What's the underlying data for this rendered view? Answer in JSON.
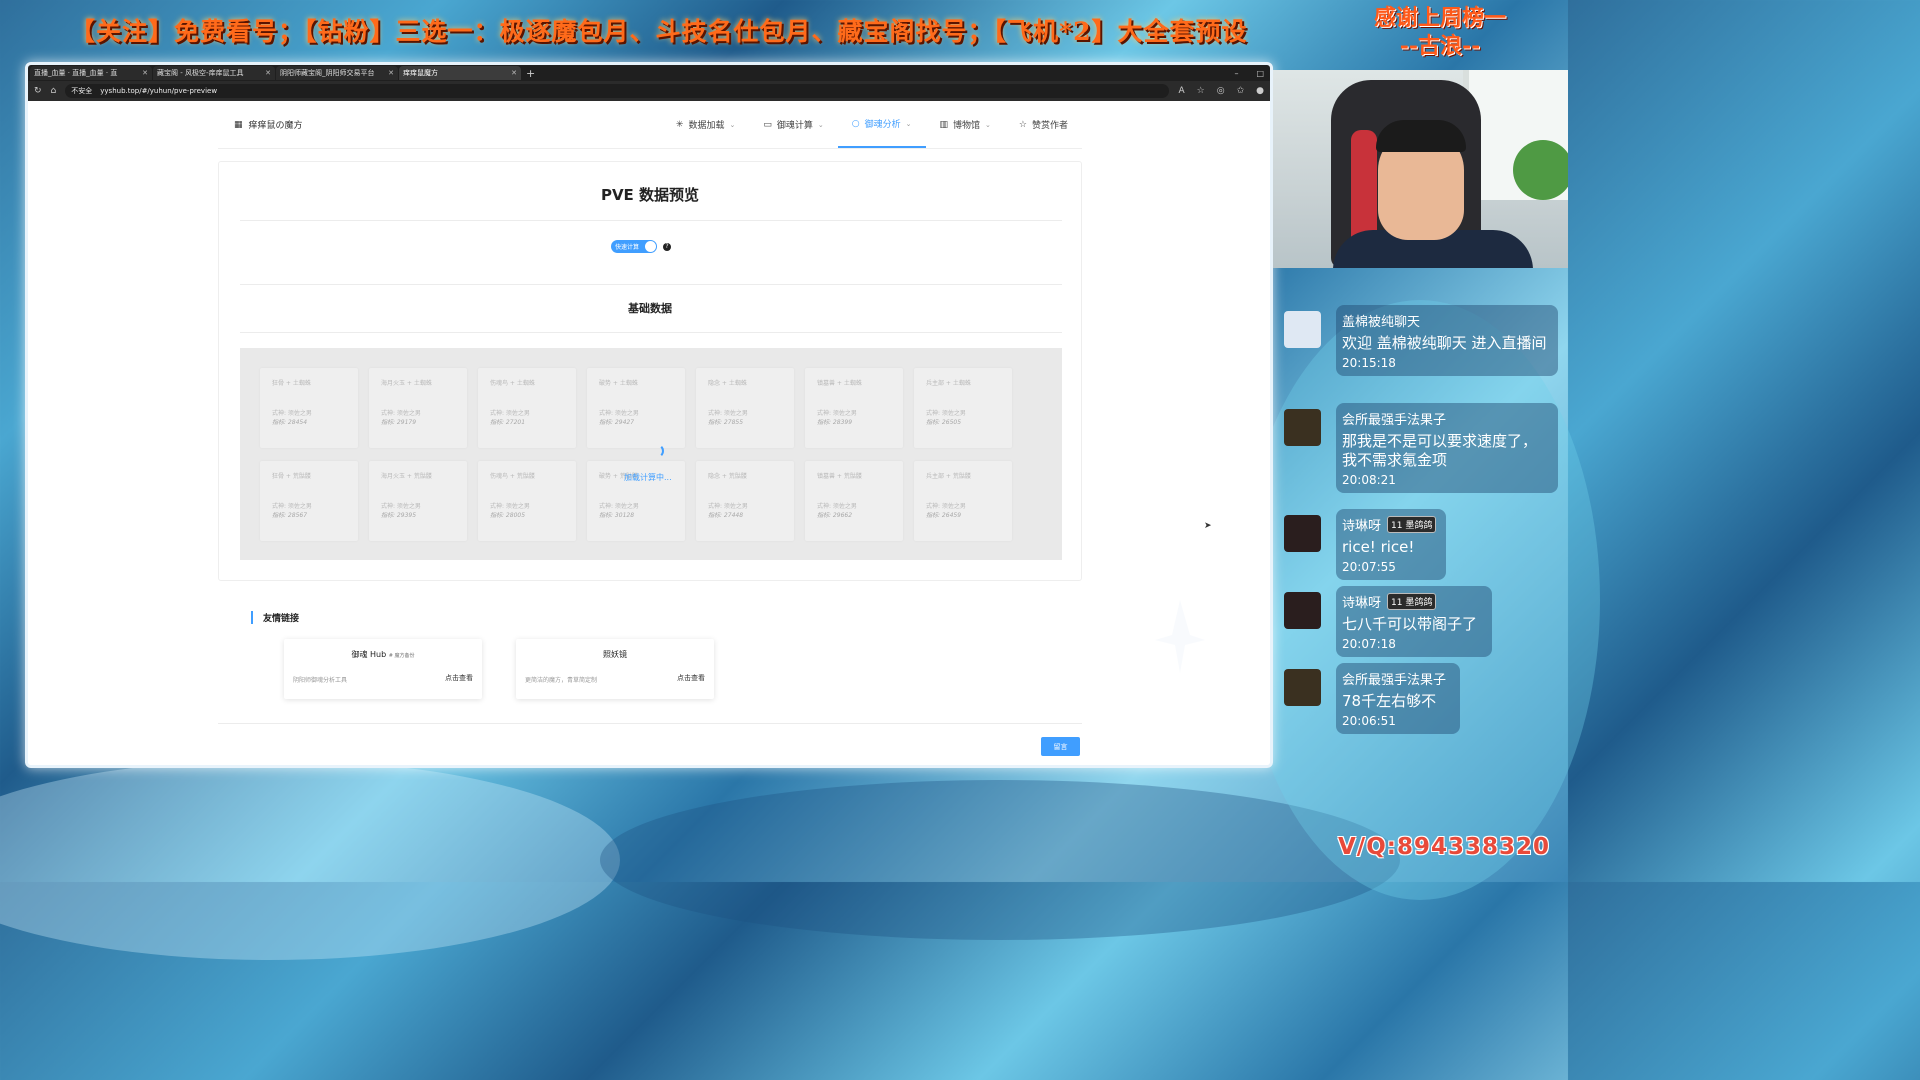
{
  "stream": {
    "banner": "【关注】免费看号；【钻粉】三选一：极逐魔包月、斗技名仕包月、藏宝阁找号；【飞机*2】大全套预设",
    "thanks_line1": "感谢上周榜一",
    "thanks_line2": "--古浪--",
    "contact": "V/Q:894338320"
  },
  "browser": {
    "tabs": [
      {
        "label": "直播_血量 · 直播_血量 · 直",
        "active": false
      },
      {
        "label": "藏宝阁 - 风极空-痒痒鼠工具",
        "active": false
      },
      {
        "label": "阴阳师藏宝阁_阴阳师交易平台",
        "active": false
      },
      {
        "label": "痒痒鼠魔方",
        "active": true
      }
    ],
    "security_label": "不安全",
    "url": "yyshub.top/#/yuhun/pve-preview"
  },
  "nav": {
    "brand": "痒痒鼠の魔方",
    "items": [
      {
        "label": "数据加载",
        "icon": "sparkle-icon",
        "active": false
      },
      {
        "label": "御魂计算",
        "icon": "monitor-icon",
        "active": false
      },
      {
        "label": "御魂分析",
        "icon": "search-icon",
        "active": true
      },
      {
        "label": "博物馆",
        "icon": "building-icon",
        "active": false
      },
      {
        "label": "赞赏作者",
        "icon": "star-icon",
        "active": false
      }
    ]
  },
  "main": {
    "title": "PVE 数据预览",
    "toggle_label": "快速计算",
    "help": "?",
    "section_title": "基础数据",
    "loading_text": "加载计算中...",
    "rows": [
      [
        {
          "name": "狂骨 + 土蜘蛛",
          "shikigami": "式神: 须佐之男",
          "metric": "指标: 28454"
        },
        {
          "name": "海月火玉 + 土蜘蛛",
          "shikigami": "式神: 须佐之男",
          "metric": "指标: 29179"
        },
        {
          "name": "伤魂鸟 + 土蜘蛛",
          "shikigami": "式神: 须佐之男",
          "metric": "指标: 27201"
        },
        {
          "name": "破势 + 土蜘蛛",
          "shikigami": "式神: 须佐之男",
          "metric": "指标: 29427"
        },
        {
          "name": "隐念 + 土蜘蛛",
          "shikigami": "式神: 须佐之男",
          "metric": "指标: 27855"
        },
        {
          "name": "镇墓兽 + 土蜘蛛",
          "shikigami": "式神: 须佐之男",
          "metric": "指标: 28399"
        },
        {
          "name": "兵主部 + 土蜘蛛",
          "shikigami": "式神: 须佐之男",
          "metric": "指标: 26505"
        }
      ],
      [
        {
          "name": "狂骨 + 荒骷髅",
          "shikigami": "式神: 须佐之男",
          "metric": "指标: 28567"
        },
        {
          "name": "海月火玉 + 荒骷髅",
          "shikigami": "式神: 须佐之男",
          "metric": "指标: 29395"
        },
        {
          "name": "伤魂鸟 + 荒骷髅",
          "shikigami": "式神: 须佐之男",
          "metric": "指标: 28005"
        },
        {
          "name": "破势 + 荒骷髅",
          "shikigami": "式神: 须佐之男",
          "metric": "指标: 30128"
        },
        {
          "name": "隐念 + 荒骷髅",
          "shikigami": "式神: 须佐之男",
          "metric": "指标: 27448"
        },
        {
          "name": "镇墓兽 + 荒骷髅",
          "shikigami": "式神: 须佐之男",
          "metric": "指标: 29662"
        },
        {
          "name": "兵主部 + 荒骷髅",
          "shikigami": "式神: 须佐之男",
          "metric": "指标: 26459"
        }
      ]
    ],
    "friend_title": "友情链接",
    "links": [
      {
        "title": "御魂 Hub",
        "tag": "# 魔方备份",
        "desc": "阴阳师御魂分析工具",
        "button": "点击查看"
      },
      {
        "title": "照妖镜",
        "tag": "",
        "desc": "更简洁的魔方，青草简定制",
        "button": "点击查看"
      }
    ],
    "message_button": "留言"
  },
  "chat": [
    {
      "user": "盖棉被纯聊天",
      "badge": "",
      "text": "欢迎 盖棉被纯聊天 进入直播间",
      "time": "20:15:18"
    },
    {
      "user": "会所最强手法果子",
      "badge": "",
      "text": "那我是不是可以要求速度了，我不需求氪金项",
      "time": "20:08:21"
    },
    {
      "user": "诗琳呀",
      "badge": "11 墨鸽鸽",
      "text": "rice! rice!",
      "time": "20:07:55"
    },
    {
      "user": "诗琳呀",
      "badge": "11 墨鸽鸽",
      "text": "七八千可以带阁子了",
      "time": "20:07:18"
    },
    {
      "user": "会所最强手法果子",
      "badge": "",
      "text": "78千左右够不",
      "time": "20:06:51"
    }
  ]
}
